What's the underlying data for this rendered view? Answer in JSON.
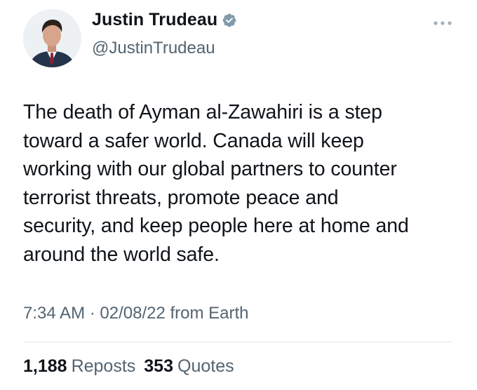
{
  "tweet": {
    "author": {
      "display_name": "Justin Trudeau",
      "handle": "@JustinTrudeau",
      "verified_icon": "verified-badge-icon",
      "verified_color": "#829aab"
    },
    "more_icon": "more-horizontal-icon",
    "text": "The death of Ayman al-Zawahiri is a step\ntoward a safer world. Canada will keep\nworking with our global partners to counter\nterrorist threats, promote peace and\nsecurity, and keep people here at home and\naround the world safe.",
    "meta": {
      "time": "7:34 AM",
      "separator": "·",
      "date": "02/08/22",
      "source": "from Earth"
    },
    "stats": {
      "reposts_count": "1,188",
      "reposts_label": "Reposts",
      "quotes_count": "353",
      "quotes_label": "Quotes"
    }
  }
}
